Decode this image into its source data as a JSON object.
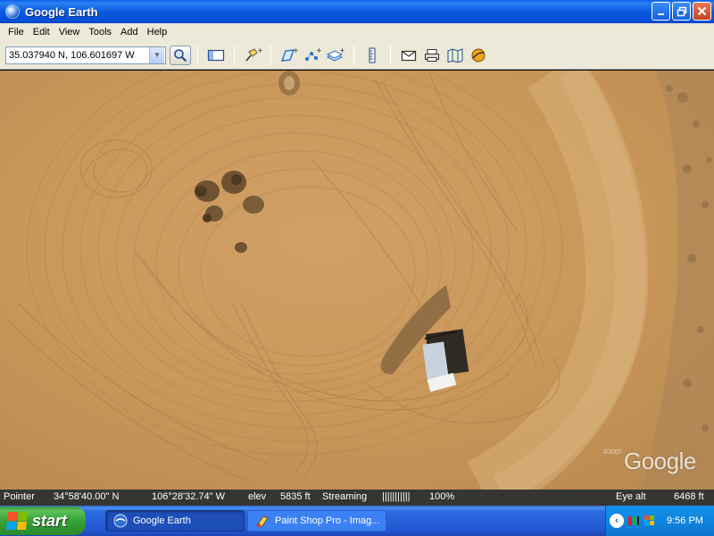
{
  "window": {
    "title": "Google Earth",
    "controls": [
      "minimize",
      "maximize",
      "close"
    ]
  },
  "menu": [
    "File",
    "Edit",
    "View",
    "Tools",
    "Add",
    "Help"
  ],
  "toolbar": {
    "search_value": "35.037940 N, 106.601697 W",
    "buttons": [
      "sidebar-toggle-icon",
      "placemark-icon",
      "polygon-icon",
      "path-icon",
      "image-overlay-icon",
      "ruler-icon",
      "email-icon",
      "print-icon",
      "google-maps-icon",
      "sky-icon"
    ]
  },
  "map": {
    "copyright": "©2007",
    "logo": "Google"
  },
  "status": {
    "pointer_label": "Pointer",
    "pointer_lat": "34°58'40.00\" N",
    "pointer_lon": "106°28'32.74\" W",
    "elev_label": "elev",
    "elev_value": "5835 ft",
    "streaming_label": "Streaming",
    "streaming_bar": "|||||||||||",
    "streaming_percent": "100%",
    "eye_alt_label": "Eye alt",
    "eye_alt_value": "6468 ft"
  },
  "taskbar": {
    "start_label": "start",
    "tasks": [
      {
        "label": "Google Earth",
        "active": true
      },
      {
        "label": "Paint Shop Pro - Imag...",
        "active": false
      }
    ],
    "clock": "9:56 PM"
  },
  "colors": {
    "titlebar": "#0c5ae0",
    "terrain": "#c8975a",
    "taskbar": "#2458d2",
    "start": "#37a237"
  }
}
